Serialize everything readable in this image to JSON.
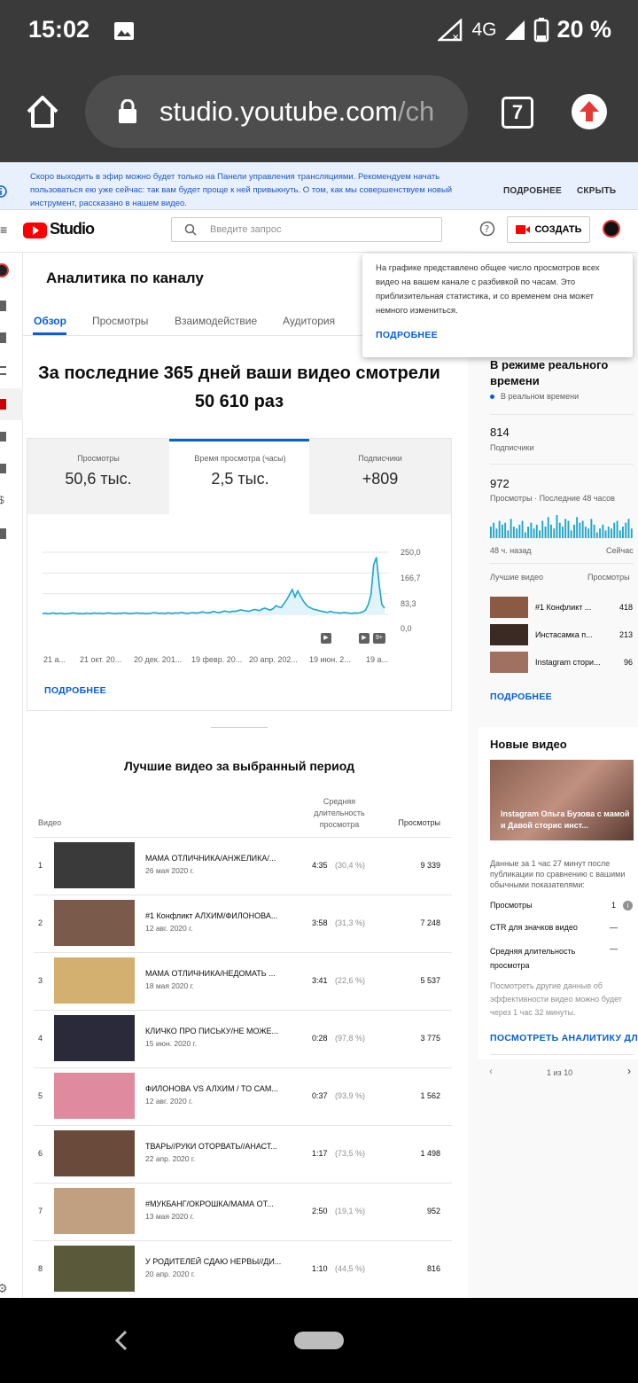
{
  "status_bar": {
    "time": "15:02",
    "network": "4G",
    "battery": "20 %"
  },
  "browser": {
    "url_main": "studio.youtube.com",
    "url_rest": "/ch",
    "tab_count": "7"
  },
  "banner": {
    "text": "Скоро выходить в эфир можно будет только на Панели управления трансляциями. Рекомендуем начать пользоваться ею уже сейчас: так вам будет проще к ней привыкнуть. О том, как мы совершенствуем новый инструмент, рассказано в нашем видео.",
    "more": "ПОДРОБНЕЕ",
    "close": "СКРЫТЬ"
  },
  "header": {
    "logo": "Studio",
    "search_placeholder": "Введите запрос",
    "create": "СОЗДАТЬ"
  },
  "analytics": {
    "title": "Аналитика по каналу",
    "tabs": [
      "Обзор",
      "Просмотры",
      "Взаимодействие",
      "Аудитория"
    ],
    "headline": "За последние 365 дней ваши видео смотрели 50 610 раз",
    "metrics": [
      {
        "label": "Просмотры",
        "value": "50,6 тыс."
      },
      {
        "label": "Время просмотра (часы)",
        "value": "2,5 тыс."
      },
      {
        "label": "Подписчики",
        "value": "+809"
      }
    ],
    "more": "ПОДРОБНЕЕ",
    "best_title": "Лучшие видео за выбранный период",
    "table_headers": {
      "video": "Видео",
      "avg": "Средняя длительность просмотра",
      "views": "Просмотры"
    }
  },
  "chart_data": {
    "type": "line",
    "x_ticks": [
      "21 а...",
      "21 окт. 20...",
      "20 дек. 201...",
      "19 февр. 20...",
      "20 апр. 202...",
      "19 июн. 2...",
      "19 а..."
    ],
    "y_ticks": [
      "250,0",
      "166,7",
      "83,3",
      "0,0"
    ],
    "ylim": [
      0,
      250
    ],
    "series": [
      {
        "values": [
          3,
          5,
          2,
          4,
          6,
          3,
          4,
          5,
          2,
          3,
          4,
          6,
          5,
          3,
          4,
          2,
          5,
          4,
          3,
          6,
          4,
          5,
          3,
          4,
          6,
          5,
          4,
          3,
          5,
          4,
          6,
          5,
          3,
          4,
          5,
          6,
          4,
          5,
          3,
          4,
          5,
          7,
          6,
          4,
          5,
          3,
          6,
          5,
          4,
          6,
          5,
          8,
          6,
          4,
          5,
          7,
          6,
          5,
          8,
          10,
          7,
          6,
          8,
          12,
          9,
          7,
          10,
          14,
          11,
          9,
          13,
          12,
          15,
          18,
          16,
          14,
          12,
          16,
          20,
          18,
          15,
          22,
          25,
          20,
          18,
          24,
          35,
          30,
          28,
          45,
          60,
          80,
          100,
          70,
          95,
          75,
          55,
          40,
          30,
          25,
          20,
          18,
          15,
          12,
          10,
          8,
          12,
          9,
          7,
          6,
          5,
          8,
          6,
          5,
          4,
          6,
          5,
          7,
          10,
          18,
          40,
          80,
          200,
          230,
          120,
          40,
          25
        ]
      }
    ],
    "markers": [
      "▶",
      "▶",
      "9+"
    ]
  },
  "top_videos": [
    {
      "rank": "1",
      "title": "МАМА ОТЛИЧНИКА/АНЖЕЛИКА/...",
      "date": "26 мая 2020 г.",
      "dur": "4:35",
      "pct": "(30,4 %)",
      "views": "9 339"
    },
    {
      "rank": "2",
      "title": "#1 Конфликт АЛХИМ/ФИЛОНОВА...",
      "date": "12 авг. 2020 г.",
      "dur": "3:58",
      "pct": "(31,3 %)",
      "views": "7 248"
    },
    {
      "rank": "3",
      "title": "МАМА ОТЛИЧНИКА/НЕДОМАТЬ ...",
      "date": "18 мая 2020 г.",
      "dur": "3:41",
      "pct": "(22,6 %)",
      "views": "5 537"
    },
    {
      "rank": "4",
      "title": "КЛИЧКО ПРО ПИСЬКУ/НЕ МОЖЕ...",
      "date": "15 июн. 2020 г.",
      "dur": "0:28",
      "pct": "(97,8 %)",
      "views": "3 775"
    },
    {
      "rank": "5",
      "title": "ФИЛОНОВА VS АЛХИМ / ТО САМ...",
      "date": "12 авг. 2020 г.",
      "dur": "0:37",
      "pct": "(93,9 %)",
      "views": "1 562"
    },
    {
      "rank": "6",
      "title": "ТВАРЬ//РУКИ ОТОРВАТЬ//АНАСТ...",
      "date": "22 апр. 2020 г.",
      "dur": "1:17",
      "pct": "(73,5 %)",
      "views": "1 498"
    },
    {
      "rank": "7",
      "title": "#МУКБАНГ/ОКРОШКА/МАМА ОТ...",
      "date": "13 мая 2020 г.",
      "dur": "2:50",
      "pct": "(19,1 %)",
      "views": "952"
    },
    {
      "rank": "8",
      "title": "У РОДИТЕЛЕЙ СДАЮ НЕРВЫ//ДИ...",
      "date": "20 апр. 2020 г.",
      "dur": "1:10",
      "pct": "(44,5 %)",
      "views": "816"
    }
  ],
  "tooltip": {
    "text": "На графике представлено общее число просмотров всех видео на вашем канале с разбивкой по часам. Это приблизительная статистика, и со временем она может немного измениться.",
    "more": "ПОДРОБНЕЕ"
  },
  "realtime": {
    "title": "В режиме реального времени",
    "live": "В реальном времени",
    "subs_value": "814",
    "subs_label": "Подписчики",
    "views_value": "972",
    "views_label": "Просмотры · Последние 48 часов",
    "ago": "48 ч. назад",
    "now": "Сейчас",
    "top_label": "Лучшие видео",
    "top_views_label": "Просмотры",
    "top": [
      {
        "title": "#1 Конфликт ...",
        "views": "418"
      },
      {
        "title": "Инстасамка п...",
        "views": "213"
      },
      {
        "title": "Instagram стори...",
        "views": "96"
      }
    ],
    "bars": [
      6,
      8,
      5,
      9,
      7,
      8,
      4,
      10,
      6,
      5,
      7,
      9,
      3,
      6,
      8,
      5,
      7,
      4,
      9,
      6,
      11,
      7,
      5,
      12,
      8,
      6,
      10,
      9,
      4,
      7,
      11,
      8,
      9,
      6,
      5,
      10,
      7,
      3,
      5,
      7,
      4,
      6,
      5,
      8,
      9,
      4,
      6,
      8,
      10,
      5
    ],
    "more": "ПОДРОБНЕЕ"
  },
  "new_videos": {
    "title": "Новые видео",
    "thumb_caption": "Instagram Ольга Бузова с мамой и Давой сторис инст...",
    "desc": "Данные за 1 час 27 минут после публикации по сравнению с вашими обычными показателями:",
    "rows": [
      {
        "label": "Просмотры",
        "value": "1"
      },
      {
        "label": "CTR для значков видео",
        "value": "—"
      },
      {
        "label": "Средняя длительность просмотра",
        "value": "—"
      }
    ],
    "note": "Посмотреть другие данные об эффективности видео можно будет через 1 час 32 минуты.",
    "link": "ПОСМОТРЕТЬ АНАЛИТИКУ ДЛЯ",
    "pager": "1 из 10"
  }
}
